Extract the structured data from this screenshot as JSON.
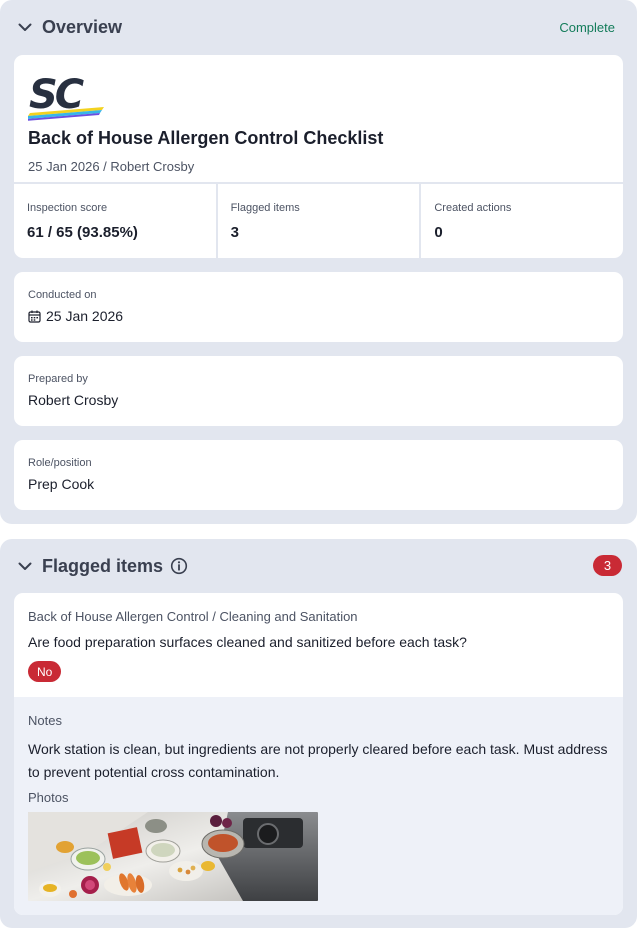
{
  "overview": {
    "title": "Overview",
    "status": "Complete",
    "logo_text": "SC",
    "doc_title": "Back of House Allergen Control Checklist",
    "doc_subtitle": "25 Jan 2026 / Robert Crosby",
    "stats": [
      {
        "label": "Inspection score",
        "value": "61 / 65 (93.85%)"
      },
      {
        "label": "Flagged items",
        "value": "3"
      },
      {
        "label": "Created actions",
        "value": "0"
      }
    ],
    "fields": {
      "conducted": {
        "label": "Conducted on",
        "value": "25 Jan 2026"
      },
      "prepared": {
        "label": "Prepared by",
        "value": "Robert Crosby"
      },
      "role": {
        "label": "Role/position",
        "value": "Prep Cook"
      }
    }
  },
  "flagged": {
    "title": "Flagged items",
    "count": "3",
    "item": {
      "breadcrumb": "Back of House Allergen Control / Cleaning and Sanitation",
      "question": "Are food preparation surfaces cleaned and sanitized before each task?",
      "answer": "No",
      "notes_label": "Notes",
      "notes": "Work station is clean, but ingredients are not properly cleared before each task. Must address to prevent potential cross contamination.",
      "photos_label": "Photos"
    }
  },
  "colors": {
    "section_bg": "#e2e6ef",
    "accent_green": "#137c5a",
    "flag_red": "#c92a35"
  },
  "icons": [
    "chevron-down-icon",
    "info-icon",
    "calendar-icon"
  ]
}
